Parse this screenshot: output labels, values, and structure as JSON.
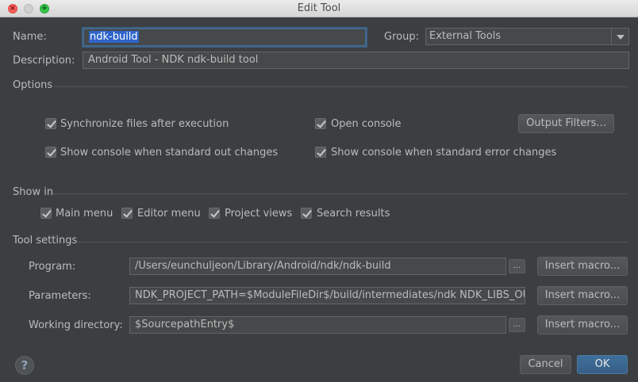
{
  "window": {
    "title": "Edit Tool"
  },
  "form": {
    "name_label": "Name:",
    "name_value": "ndk-build",
    "group_label": "Group:",
    "group_value": "External Tools",
    "description_label": "Description:",
    "description_value": "Android Tool - NDK ndk-build tool"
  },
  "options": {
    "title": "Options",
    "sync_files": {
      "label": "Synchronize files after execution",
      "checked": true
    },
    "open_console": {
      "label": "Open console",
      "checked": true
    },
    "output_filters_button": "Output Filters...",
    "show_console_stdout": {
      "label": "Show console when standard out changes",
      "checked": true
    },
    "show_console_stderr": {
      "label": "Show console when standard error changes",
      "checked": true
    }
  },
  "show_in": {
    "title": "Show in",
    "main_menu": {
      "label": "Main menu",
      "checked": true
    },
    "editor_menu": {
      "label": "Editor menu",
      "checked": true
    },
    "project_views": {
      "label": "Project views",
      "checked": true
    },
    "search_results": {
      "label": "Search results",
      "checked": true
    }
  },
  "tool_settings": {
    "title": "Tool settings",
    "program_label": "Program:",
    "program_value": "/Users/eunchuljeon/Library/Android/ndk/ndk-build",
    "parameters_label": "Parameters:",
    "parameters_value": "NDK_PROJECT_PATH=$ModuleFileDir$/build/intermediates/ndk NDK_LIBS_OUT=",
    "working_dir_label": "Working directory:",
    "working_dir_value": "$SourcepathEntry$",
    "browse_label": "...",
    "insert_macro_label": "Insert macro..."
  },
  "footer": {
    "help_label": "?",
    "cancel_label": "Cancel",
    "ok_label": "OK"
  },
  "colors": {
    "background": "#3c3f41",
    "accent": "#365f86",
    "selection": "#2f65ca"
  }
}
